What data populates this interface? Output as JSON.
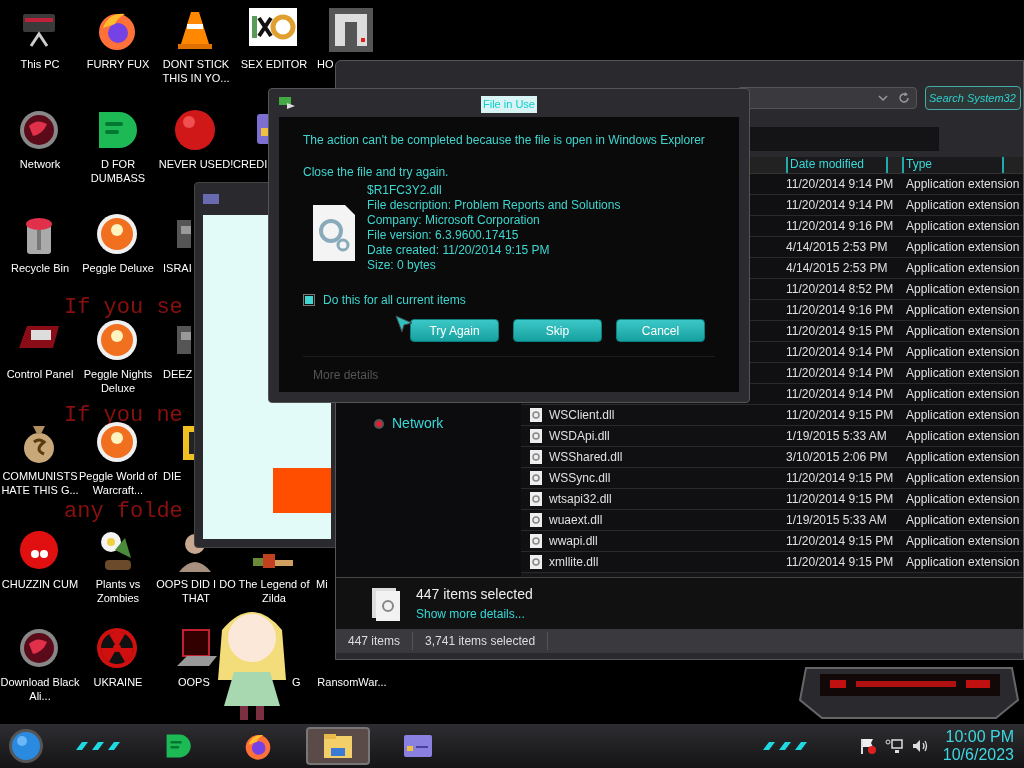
{
  "desktop": {
    "wallpaper_lines": [
      "If you se",
      "If you ne",
      "any folde"
    ],
    "icons": [
      {
        "label": "This PC",
        "kind": "monitor"
      },
      {
        "label": "FURRY FUX",
        "kind": "browser"
      },
      {
        "label": "DONT STICK THIS IN YO...",
        "kind": "cone"
      },
      {
        "label": "SEX EDITOR",
        "kind": "editor"
      },
      {
        "label": "HO",
        "kind": "maze"
      },
      {
        "label": "Network",
        "kind": "globe"
      },
      {
        "label": "D FOR DUMBASS",
        "kind": "notes"
      },
      {
        "label": "NEVER USED!",
        "kind": "redball"
      },
      {
        "label": "CREDI",
        "kind": "card"
      },
      {
        "label": "Recycle Bin",
        "kind": "bin"
      },
      {
        "label": "Peggle Deluxe",
        "kind": "peggle"
      },
      {
        "label": "ISRAI",
        "kind": "small"
      },
      {
        "label": "Control Panel",
        "kind": "panel"
      },
      {
        "label": "Peggle Nights Deluxe",
        "kind": "peggle"
      },
      {
        "label": "DEEZ",
        "kind": "small"
      },
      {
        "label": "COMMUNISTS HATE THIS G...",
        "kind": "moneybag"
      },
      {
        "label": "Peggle World of Warcraft...",
        "kind": "peggle"
      },
      {
        "label": "DIE",
        "kind": "folder"
      },
      {
        "label": "CHUZZIN CUM",
        "kind": "fuzzball"
      },
      {
        "label": "Plants vs Zombies",
        "kind": "flower"
      },
      {
        "label": "OOPS DID I DO THAT",
        "kind": "portrait"
      },
      {
        "label": "The Legend of Zilda",
        "kind": "sprite"
      },
      {
        "label": "Mi",
        "kind": "none"
      },
      {
        "label": "Download Black Ali...",
        "kind": "globe"
      },
      {
        "label": "UKRAINE",
        "kind": "radiation"
      },
      {
        "label": "OOPS",
        "kind": "laptop"
      },
      {
        "label": "G",
        "kind": "none"
      },
      {
        "label": "RansomWar...",
        "kind": "none"
      }
    ]
  },
  "explorer": {
    "search": {
      "placeholder": "Search System32"
    },
    "columns": [
      "Date modified",
      "Type"
    ],
    "nav_items": [
      {
        "label": "Network"
      }
    ],
    "rows": [
      {
        "date": "11/20/2014 9:14 PM",
        "type": "Application extension"
      },
      {
        "date": "11/20/2014 9:14 PM",
        "type": "Application extension"
      },
      {
        "date": "11/20/2014 9:16 PM",
        "type": "Application extension"
      },
      {
        "date": "4/14/2015 2:53 PM",
        "type": "Application extension"
      },
      {
        "date": "4/14/2015 2:53 PM",
        "type": "Application extension"
      },
      {
        "date": "11/20/2014 8:52 PM",
        "type": "Application extension"
      },
      {
        "date": "11/20/2014 9:16 PM",
        "type": "Application extension"
      },
      {
        "date": "11/20/2014 9:15 PM",
        "type": "Application extension"
      },
      {
        "date": "11/20/2014 9:14 PM",
        "type": "Application extension"
      },
      {
        "date": "11/20/2014 9:14 PM",
        "type": "Application extension"
      },
      {
        "date": "11/20/2014 9:14 PM",
        "type": "Application extension"
      },
      {
        "name": "WSClient.dll",
        "date": "11/20/2014 9:15 PM",
        "type": "Application extension"
      },
      {
        "name": "WSDApi.dll",
        "date": "1/19/2015 5:33 AM",
        "type": "Application extension"
      },
      {
        "name": "WSShared.dll",
        "date": "3/10/2015 2:06 PM",
        "type": "Application extension"
      },
      {
        "name": "WSSync.dll",
        "date": "11/20/2014 9:15 PM",
        "type": "Application extension"
      },
      {
        "name": "wtsapi32.dll",
        "date": "11/20/2014 9:15 PM",
        "type": "Application extension"
      },
      {
        "name": "wuaext.dll",
        "date": "1/19/2015 5:33 AM",
        "type": "Application extension"
      },
      {
        "name": "wwapi.dll",
        "date": "11/20/2014 9:15 PM",
        "type": "Application extension"
      },
      {
        "name": "xmllite.dll",
        "date": "11/20/2014 9:15 PM",
        "type": "Application extension"
      }
    ],
    "details": {
      "title": "447 items selected",
      "link": "Show more details..."
    },
    "status_bar": [
      "447 items",
      "3,741 items selected"
    ]
  },
  "dialog": {
    "title": "File in Use",
    "message": "The action can't be completed because the file is open in Windows Explorer",
    "instruction": "Close the file and try again.",
    "file_lines": [
      "$R1FC3Y2.dll",
      "File description: Problem Reports and Solutions",
      "Company: Microsoft Corporation",
      "File version: 6.3.9600.17415",
      "Date created: 11/20/2014 9:15 PM",
      "Size: 0 bytes"
    ],
    "checkbox": {
      "label": "Do this for all current items",
      "checked": true
    },
    "buttons": [
      "Try Again",
      "Skip",
      "Cancel"
    ],
    "more_details": "More details"
  },
  "taskbar": {
    "items": [
      {
        "kind": "notes",
        "selected": false
      },
      {
        "kind": "browser",
        "selected": false
      },
      {
        "kind": "explorer",
        "selected": true
      },
      {
        "kind": "card",
        "selected": false
      }
    ],
    "clock": {
      "time": "10:00 PM",
      "date": "10/6/2023"
    }
  }
}
